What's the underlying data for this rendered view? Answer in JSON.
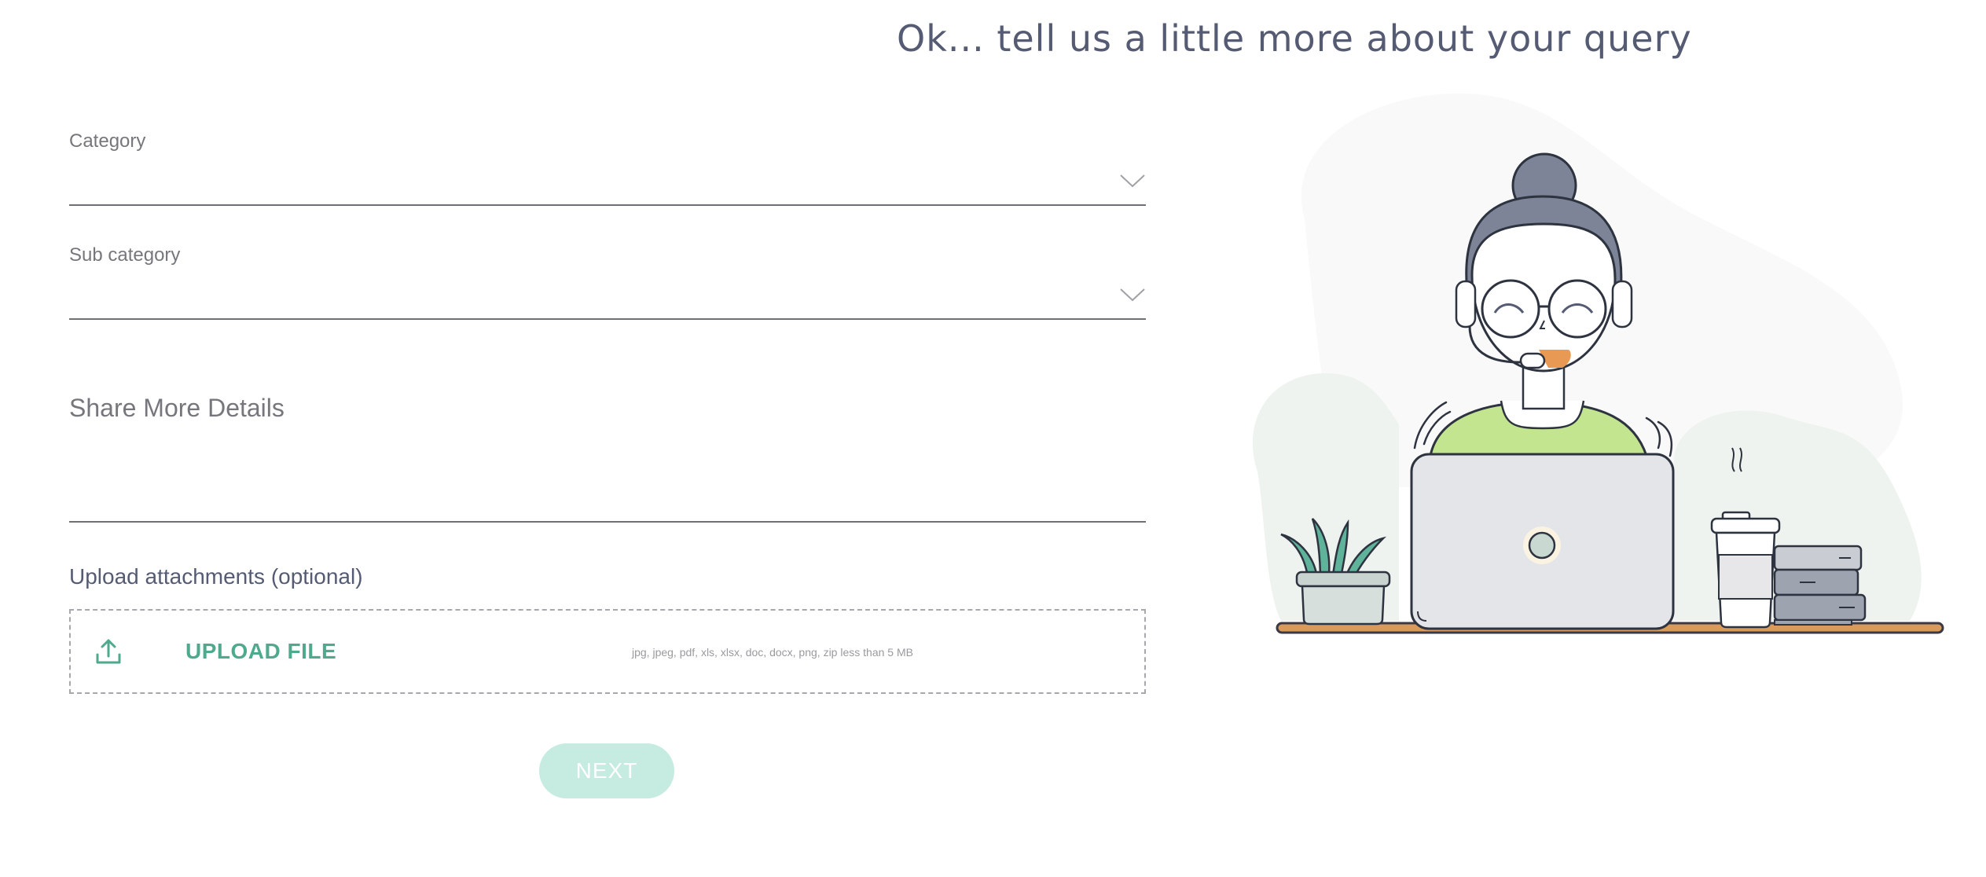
{
  "header": {
    "title": "Ok... tell us a little more about your query"
  },
  "form": {
    "category": {
      "label": "Category",
      "value": ""
    },
    "subcategory": {
      "label": "Sub category",
      "value": ""
    },
    "details": {
      "label": "Share More Details",
      "value": ""
    },
    "upload": {
      "label": "Upload attachments (optional)",
      "button_label": "UPLOAD FILE",
      "hint": "jpg, jpeg, pdf, xls, xlsx, doc, docx, png, zip less than 5 MB",
      "icon": "upload-icon"
    },
    "next_label": "NEXT"
  },
  "illustration": {
    "subject": "support-agent-with-laptop"
  },
  "colors": {
    "accent": "#4fa98d",
    "next_button_bg": "#c6ebe1",
    "title": "#545b73",
    "hair": "#7d8497",
    "shirt": "#c3e58f",
    "desk": "#d99a5b"
  }
}
